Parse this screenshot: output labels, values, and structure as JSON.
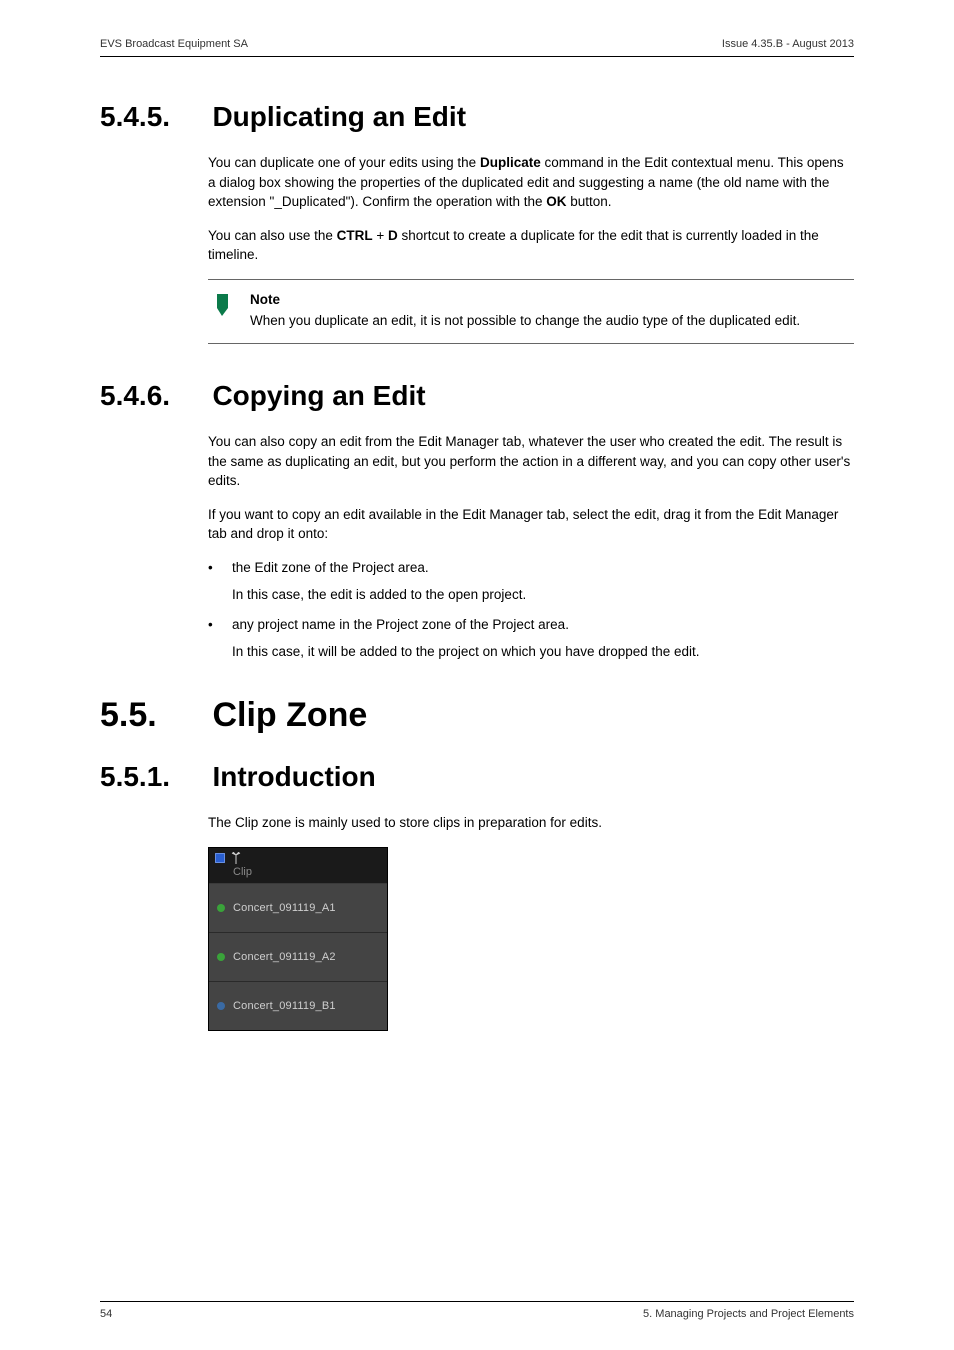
{
  "header": {
    "left": "EVS Broadcast Equipment SA",
    "right": "Issue 4.35.B - August 2013"
  },
  "s545": {
    "num": "5.4.5.",
    "title": "Duplicating an Edit",
    "p1_a": "You can duplicate one of your edits using the ",
    "p1_b": "Duplicate",
    "p1_c": " command in the Edit contextual menu. This opens a dialog box showing the properties of the duplicated edit and suggesting a name (the old name with the extension \"_Duplicated\"). Confirm the operation with the ",
    "p1_d": "OK",
    "p1_e": " button.",
    "p2_a": "You can also use the ",
    "p2_b": "CTRL",
    "p2_c": " + ",
    "p2_d": "D",
    "p2_e": " shortcut to create a duplicate for the edit that is currently loaded in the timeline.",
    "note_hd": "Note",
    "note_txt": "When you duplicate an edit, it is not possible to change the audio type of the duplicated edit."
  },
  "s546": {
    "num": "5.4.6.",
    "title": "Copying an Edit",
    "p1": "You can also copy an edit from the Edit Manager tab, whatever the user who created the edit. The result is the same as duplicating an edit, but you perform the action in a different way, and you can copy other user's edits.",
    "p2": "If you want to copy an edit available in the Edit Manager tab, select the edit, drag it from the Edit Manager tab and drop it onto:",
    "b1": "the Edit zone of the Project area.",
    "b1s": "In this case, the edit is added to the open project.",
    "b2": "any project name in the Project zone of the Project area.",
    "b2s": "In this case, it will be added to the project on which you have dropped the edit."
  },
  "s55": {
    "num": "5.5.",
    "title": "Clip Zone"
  },
  "s551": {
    "num": "5.5.1.",
    "title": "Introduction",
    "p1": "The Clip zone is mainly used to store clips in preparation for edits."
  },
  "clipzone": {
    "header_label": "Clip",
    "items": [
      {
        "label": "Concert_091119_A1",
        "color": "#3aa33a"
      },
      {
        "label": "Concert_091119_A2",
        "color": "#3aa33a"
      },
      {
        "label": "Concert_091119_B1",
        "color": "#3a6aa3"
      }
    ],
    "icon_colors": {
      "square": "#2a5fd0",
      "antenna": "#cfcfcf"
    }
  },
  "footer": {
    "left": "54",
    "right": "5. Managing Projects and Project Elements"
  }
}
